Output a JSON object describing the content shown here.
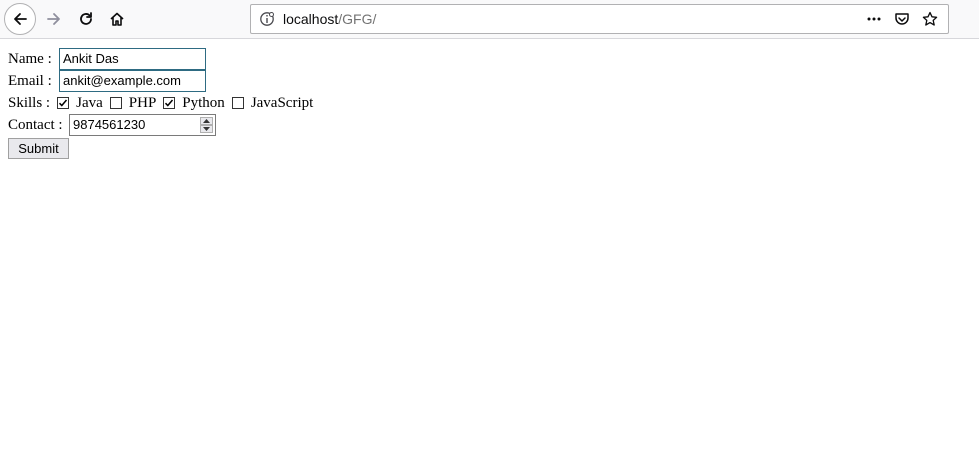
{
  "browser": {
    "url_host": "localhost",
    "url_path": "/GFG/"
  },
  "form": {
    "name_label": "Name :",
    "name_value": "Ankit Das",
    "email_label": "Email :",
    "email_value": "ankit@example.com",
    "skills_label": "Skills :",
    "skills": [
      {
        "label": "Java",
        "checked": true
      },
      {
        "label": "PHP",
        "checked": false
      },
      {
        "label": "Python",
        "checked": true
      },
      {
        "label": "JavaScript",
        "checked": false
      }
    ],
    "contact_label": "Contact :",
    "contact_value": "9874561230",
    "submit_label": "Submit"
  },
  "colors": {
    "toolbar_bg": "#f9f9fa",
    "focused_input_border": "#2e6b82"
  }
}
